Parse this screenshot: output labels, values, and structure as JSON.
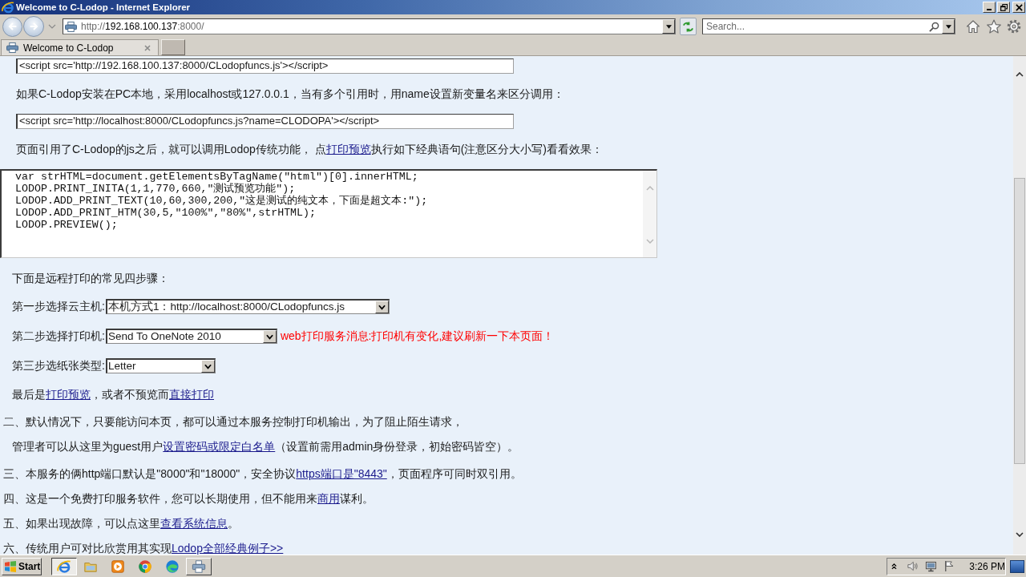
{
  "window": {
    "title": "Welcome to C-Lodop - Internet Explorer"
  },
  "address_bar": {
    "scheme": "http://",
    "host": "192.168.100.137",
    "rest": ":8000/"
  },
  "search": {
    "placeholder": "Search..."
  },
  "tabs": [
    {
      "label": "Welcome to C-Lodop",
      "selected": true
    }
  ],
  "page": {
    "blocks": [
      {
        "kind": "field",
        "value": "<script src='http://192.168.100.137:8000/CLodopfuncs.js'></script>"
      },
      {
        "kind": "intro",
        "parts": [
          {
            "text": "如果C-Lodop安装在PC本地，采用localhost或127.0.0.1，当有多个引用时，用name设置新变量名来区分调用：",
            "link": false
          }
        ]
      },
      {
        "kind": "field",
        "value": "<script src='http://localhost:8000/CLodopfuncs.js?name=CLODOPA'></script>"
      },
      {
        "kind": "intro",
        "parts": [
          {
            "text": "页面引用了C-Lodop的js之后，就可以调用Lodop传统功能， 点",
            "link": false
          },
          {
            "text": "打印预览",
            "link": true
          },
          {
            "text": "执行如下经典语句(注意区分大小写)看看效果：",
            "link": false
          }
        ]
      },
      {
        "kind": "code",
        "lines": [
          "var strHTML=document.getElementsByTagName(\"html\")[0].innerHTML;",
          "LODOP.PRINT_INITA(1,1,770,660,\"测试预览功能\");",
          "LODOP.ADD_PRINT_TEXT(10,60,300,200,\"这是测试的纯文本，下面是超文本:\");",
          "LODOP.ADD_PRINT_HTM(30,5,\"100%\",\"80%\",strHTML);",
          "LODOP.PREVIEW();"
        ]
      },
      {
        "kind": "text",
        "parts": [
          {
            "text": "下面是远程打印的常见四步骤：",
            "link": false
          }
        ]
      },
      {
        "kind": "step",
        "label": "第一步选择云主机:",
        "value": "本机方式1：http://localhost:8000/CLodopfuncs.js"
      },
      {
        "kind": "step",
        "label": "第二步选择打印机:",
        "value": "Send To OneNote 2010",
        "message": "web打印服务消息:打印机有变化,建议刷新一下本页面！"
      },
      {
        "kind": "step",
        "label": "第三步选纸张类型:",
        "value": "Letter"
      },
      {
        "kind": "text",
        "parts": [
          {
            "text": "最后是",
            "link": false
          },
          {
            "text": "打印预览",
            "link": true
          },
          {
            "text": "，或者不预览而",
            "link": false
          },
          {
            "text": "直接打印",
            "link": true
          }
        ]
      },
      {
        "kind": "numbered",
        "parts": [
          {
            "text": "二、默认情况下，只要能访问本页，都可以通过本服务控制打印机输出，为了阻止陌生请求，",
            "link": false
          }
        ]
      },
      {
        "kind": "text",
        "parts": [
          {
            "text": "管理者可以从这里为guest用户",
            "link": false
          },
          {
            "text": "设置密码或限定白名单",
            "link": true
          },
          {
            "text": "（设置前需用admin身份登录，初始密码皆空）。",
            "link": false
          }
        ]
      },
      {
        "kind": "numbered",
        "parts": [
          {
            "text": "三、本服务的俩http端口默认是\"8000\"和\"18000\"，安全协议",
            "link": false
          },
          {
            "text": "https端口是\"8443\"",
            "link": true
          },
          {
            "text": "，页面程序可同时双引用。",
            "link": false
          }
        ]
      },
      {
        "kind": "numbered",
        "parts": [
          {
            "text": "四、这是一个免费打印服务软件，您可以长期使用，但不能用来",
            "link": false
          },
          {
            "text": "商用",
            "link": true
          },
          {
            "text": "谋利。",
            "link": false
          }
        ]
      },
      {
        "kind": "numbered",
        "parts": [
          {
            "text": "五、如果出现故障，可以点这里",
            "link": false
          },
          {
            "text": "查看系统信息",
            "link": true
          },
          {
            "text": "。",
            "link": false
          }
        ]
      },
      {
        "kind": "numbered",
        "parts": [
          {
            "text": "六、传统用户可对比欣赏用其实现",
            "link": false
          },
          {
            "text": "Lodop全部经典例子>>",
            "link": true
          }
        ]
      }
    ]
  },
  "taskbar": {
    "start_label": "Start",
    "items": [
      {
        "kind": "window",
        "selected": true
      },
      {
        "kind": "pinned",
        "selected": false
      },
      {
        "kind": "pinned",
        "selected": false
      },
      {
        "kind": "pinned",
        "selected": false
      },
      {
        "kind": "pinned",
        "selected": false
      },
      {
        "kind": "window",
        "selected": false
      }
    ],
    "clock": "3:26 PM"
  }
}
